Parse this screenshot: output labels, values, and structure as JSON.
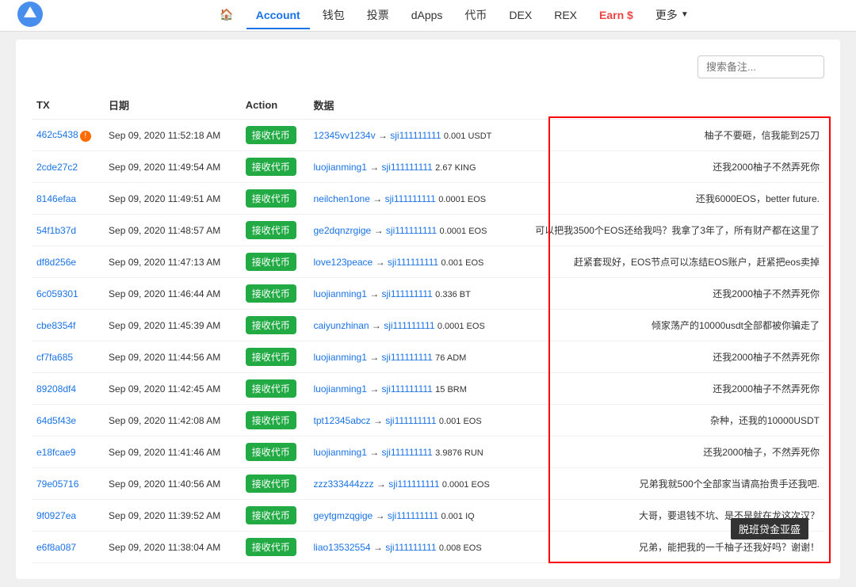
{
  "nav": {
    "home_label": "🏠",
    "account_label": "Account",
    "wallet_label": "钱包",
    "vote_label": "投票",
    "dapps_label": "dApps",
    "token_label": "代币",
    "dex_label": "DEX",
    "rex_label": "REX",
    "earn_label": "Earn $",
    "more_label": "更多"
  },
  "table": {
    "col_tx": "TX",
    "col_date": "日期",
    "col_action": "Action",
    "col_data": "数据",
    "search_placeholder": "搜索备注...",
    "rows": [
      {
        "tx": "462c5438",
        "warn": true,
        "date": "Sep 09, 2020 11:52:18 AM",
        "action": "接收代币",
        "flow": "12345vv1234v → sji111111111",
        "amount": "0.001 USDT",
        "memo": "柚子不要砸，信我能到25刀"
      },
      {
        "tx": "2cde27c2",
        "warn": false,
        "date": "Sep 09, 2020 11:49:54 AM",
        "action": "接收代币",
        "flow": "luojianming1 → sji111111111",
        "amount": "2.67 KING",
        "memo": "还我2000柚子不然弄死你"
      },
      {
        "tx": "8146efaa",
        "warn": false,
        "date": "Sep 09, 2020 11:49:51 AM",
        "action": "接收代币",
        "flow": "neilchen1one → sji111111111",
        "amount": "0.0001 EOS",
        "memo": "还我6000EOS，better future."
      },
      {
        "tx": "54f1b37d",
        "warn": false,
        "date": "Sep 09, 2020 11:48:57 AM",
        "action": "接收代币",
        "flow": "ge2dqnzrgige → sji111111111",
        "amount": "0.0001 EOS",
        "memo": "可以把我3500个EOS还给我吗？我拿了3年了，所有财产都在这里了"
      },
      {
        "tx": "df8d256e",
        "warn": false,
        "date": "Sep 09, 2020 11:47:13 AM",
        "action": "接收代币",
        "flow": "love123peace → sji111111111",
        "amount": "0.001 EOS",
        "memo": "赶紧套现好，EOS节点可以冻结EOS账户，赶紧把eos卖掉"
      },
      {
        "tx": "6c059301",
        "warn": false,
        "date": "Sep 09, 2020 11:46:44 AM",
        "action": "接收代币",
        "flow": "luojianming1 → sji111111111",
        "amount": "0.336 BT",
        "memo": "还我2000柚子不然弄死你"
      },
      {
        "tx": "cbe8354f",
        "warn": false,
        "date": "Sep 09, 2020 11:45:39 AM",
        "action": "接收代币",
        "flow": "caiyunzhinan → sji111111111",
        "amount": "0.0001 EOS",
        "memo": "倾家荡产的10000usdt全部都被你骗走了"
      },
      {
        "tx": "cf7fa685",
        "warn": false,
        "date": "Sep 09, 2020 11:44:56 AM",
        "action": "接收代币",
        "flow": "luojianming1 → sji111111111",
        "amount": "76 ADM",
        "memo": "还我2000柚子不然弄死你"
      },
      {
        "tx": "89208df4",
        "warn": false,
        "date": "Sep 09, 2020 11:42:45 AM",
        "action": "接收代币",
        "flow": "luojianming1 → sji111111111",
        "amount": "15 BRM",
        "memo": "还我2000柚子不然弄死你"
      },
      {
        "tx": "64d5f43e",
        "warn": false,
        "date": "Sep 09, 2020 11:42:08 AM",
        "action": "接收代币",
        "flow": "tpt12345abcz → sji111111111",
        "amount": "0.001 EOS",
        "memo": "杂种，还我的10000USDT"
      },
      {
        "tx": "e18fcae9",
        "warn": false,
        "date": "Sep 09, 2020 11:41:46 AM",
        "action": "接收代币",
        "flow": "luojianming1 → sji111111111",
        "amount": "3.9876 RUN",
        "memo": "还我2000柚子，不然弄死你"
      },
      {
        "tx": "79e05716",
        "warn": false,
        "date": "Sep 09, 2020 11:40:56 AM",
        "action": "接收代币",
        "flow": "zzz333444zzz → sji111111111",
        "amount": "0.0001 EOS",
        "memo": "兄弟我就500个全部家当请高抬贵手还我吧."
      },
      {
        "tx": "9f0927ea",
        "warn": false,
        "date": "Sep 09, 2020 11:39:52 AM",
        "action": "接收代币",
        "flow": "geytgmzqgige → sji111111111",
        "amount": "0.001 IQ",
        "memo": "大哥，要退钱不坑、是不是就在龙这次汉？"
      },
      {
        "tx": "e6f8a087",
        "warn": false,
        "date": "Sep 09, 2020 11:38:04 AM",
        "action": "接收代币",
        "flow": "liao13532554 → sji111111111",
        "amount": "0.008 EOS",
        "memo": "兄弟，能把我的一千柚子还我好吗？谢谢！"
      }
    ]
  },
  "watermark": "脱班贷金亚盛"
}
